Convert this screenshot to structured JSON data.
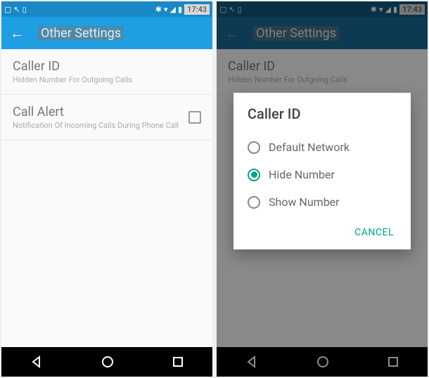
{
  "statusbar": {
    "time": "17:43"
  },
  "appbar": {
    "title": "Other Settings"
  },
  "settings": {
    "caller_id": {
      "title": "Caller ID",
      "subtitle": "Hidden Number For Outgoing Calls"
    },
    "call_alert": {
      "title": "Call Alert",
      "subtitle": "Notification Of Incoming Calls During Phone Call"
    }
  },
  "dialog": {
    "title": "Caller ID",
    "options": {
      "opt0": "Default Network",
      "opt1": "Hide Number",
      "opt2": "Show Number"
    },
    "cancel": "CANCEL"
  }
}
